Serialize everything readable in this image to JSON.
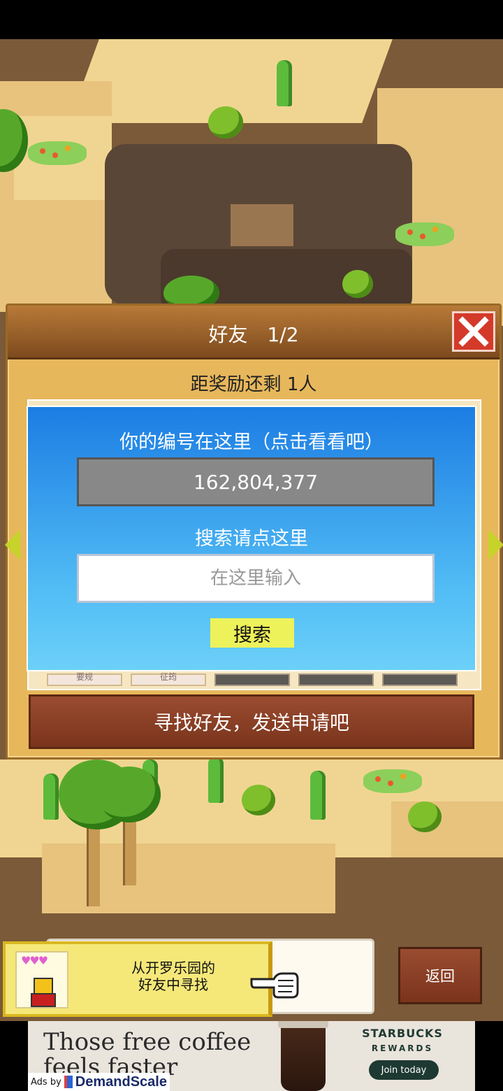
{
  "dialog": {
    "title": "好友　1/2",
    "reward_remaining": "距奖励还剩 1人",
    "find_friends_button": "寻找好友，发送申请吧"
  },
  "search_panel": {
    "id_label": "你的编号在这里（点击看看吧）",
    "player_id": "162,804,377",
    "search_label": "搜索请点这里",
    "search_placeholder": "在这里输入",
    "search_button": "搜索"
  },
  "friend_slots": [
    {
      "label": "要规",
      "state": "light"
    },
    {
      "label": "征筠",
      "state": "light"
    },
    {
      "label": "",
      "state": "empty"
    },
    {
      "label": "",
      "state": "empty"
    },
    {
      "label": "",
      "state": "empty"
    }
  ],
  "bottom_bar": {
    "hint_text": "从开罗乐园的\n好友中寻找",
    "back_button": "返回"
  },
  "ad": {
    "headline": "Those free coffee feels faster",
    "brand": "STARBUCKS",
    "program": "REWARDS",
    "cta": "Join today",
    "ads_by": "Ads by",
    "network": "DemandScale"
  },
  "colors": {
    "dialog_bg": "#e7b75c",
    "search_panel_top": "#1c7de3",
    "search_button": "#eef25a",
    "close_button": "#d43a2a"
  }
}
